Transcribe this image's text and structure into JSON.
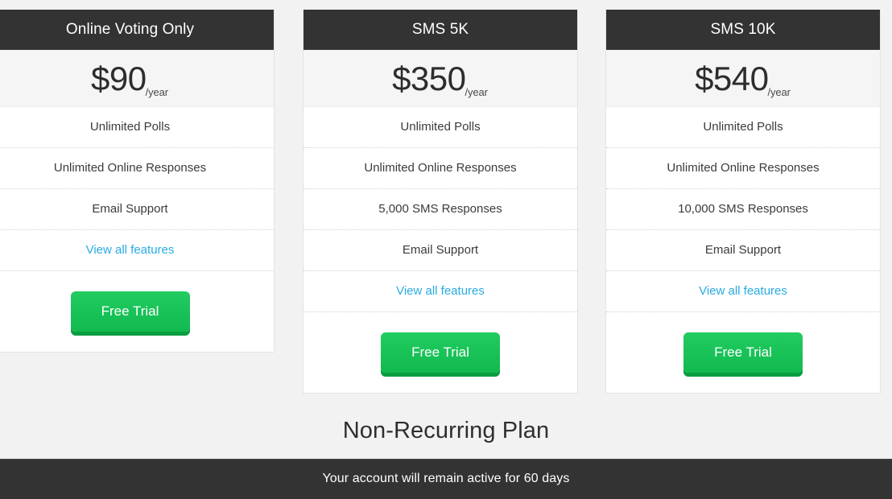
{
  "background_color": "#f2f2f2",
  "accent_colors": {
    "header_dark": "#333333",
    "price_band": "#f5f5f5",
    "cta_green": "#1ec65c",
    "cta_green_shadow": "#0a9c40",
    "link_blue": "#29abe2",
    "card_border": "#e3e3e3"
  },
  "plans": [
    {
      "name": "Online Voting Only",
      "price_amount": "$90",
      "price_period": "/year",
      "features": [
        "Unlimited Polls",
        "Unlimited Online Responses",
        "Email Support"
      ],
      "view_all_label": "View all features",
      "cta_label": "Free Trial"
    },
    {
      "name": "SMS 5K",
      "price_amount": "$350",
      "price_period": "/year",
      "features": [
        "Unlimited Polls",
        "Unlimited Online Responses",
        "5,000 SMS Responses",
        "Email Support"
      ],
      "view_all_label": "View all features",
      "cta_label": "Free Trial"
    },
    {
      "name": "SMS 10K",
      "price_amount": "$540",
      "price_period": "/year",
      "features": [
        "Unlimited Polls",
        "Unlimited Online Responses",
        "10,000 SMS Responses",
        "Email Support"
      ],
      "view_all_label": "View all features",
      "cta_label": "Free Trial"
    }
  ],
  "bottom": {
    "heading": "Non-Recurring Plan",
    "footer_note": "Your account will remain active for 60 days"
  }
}
